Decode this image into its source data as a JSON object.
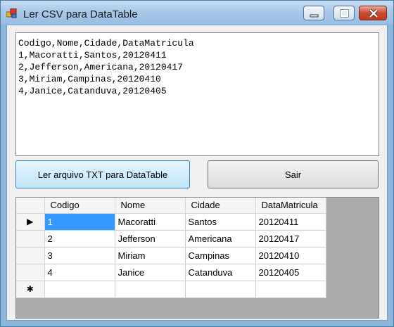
{
  "window": {
    "title": "Ler CSV para DataTable"
  },
  "textbox": {
    "content": "Codigo,Nome,Cidade,DataMatricula\n1,Macoratti,Santos,20120411\n2,Jefferson,Americana,20120417\n3,Miriam,Campinas,20120410\n4,Janice,Catanduva,20120405"
  },
  "buttons": {
    "read_label": "Ler arquivo TXT para DataTable",
    "exit_label": "Sair"
  },
  "grid": {
    "columns": [
      "Codigo",
      "Nome",
      "Cidade",
      "DataMatricula"
    ],
    "rows": [
      [
        "1",
        "Macoratti",
        "Santos",
        "20120411"
      ],
      [
        "2",
        "Jefferson",
        "Americana",
        "20120417"
      ],
      [
        "3",
        "Miriam",
        "Campinas",
        "20120410"
      ],
      [
        "4",
        "Janice",
        "Catanduva",
        "20120405"
      ]
    ],
    "current_row_marker": "▶",
    "new_row_marker": "✱"
  },
  "colors": {
    "selection": "#3399ff",
    "grid_background": "#ababab"
  }
}
